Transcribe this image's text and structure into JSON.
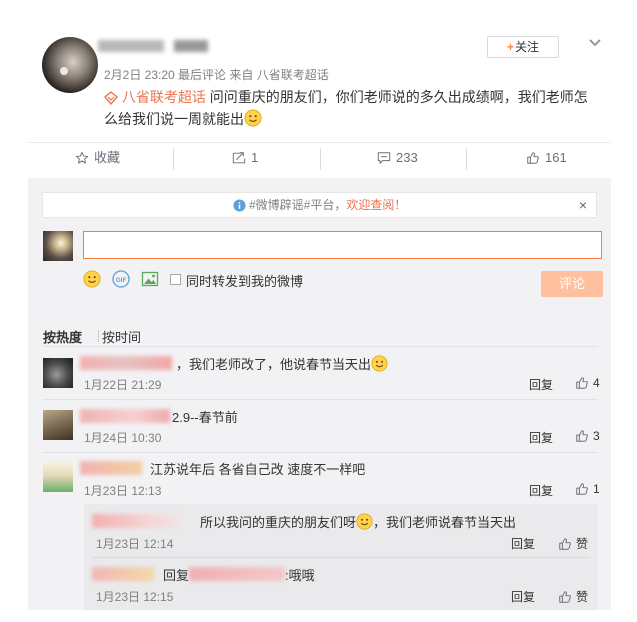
{
  "post": {
    "meta": "2月2日 23:20 最后评论 来自 八省联考超话",
    "follow_label": "关注",
    "tag": "八省联考超话",
    "text_line1": " 问问重庆的朋友们，你们老师说的多久出成绩啊，我们老师怎",
    "text_line2": "么给我们说一周就能出"
  },
  "actions": {
    "collect_label": "收藏",
    "forward_count": "1",
    "comment_count": "233",
    "like_count": "161"
  },
  "notice": {
    "hash_text": "#微博辟谣#平台，",
    "link_text": "欢迎查阅！",
    "close": "×"
  },
  "composer": {
    "input_value": "",
    "forward_label": "同时转发到我的微博",
    "submit_label": "评论"
  },
  "sort": {
    "hot_label": "按热度",
    "time_label": "按时间"
  },
  "comments": [
    {
      "text": "，我们老师改了，他说春节当天出",
      "time": "1月22日 21:29",
      "reply": "回复",
      "likes": "4"
    },
    {
      "text": "2.9--春节前",
      "time": "1月24日 10:30",
      "reply": "回复",
      "likes": "3"
    },
    {
      "text": "江苏说年后 各省自己改 速度不一样吧",
      "time": "1月23日 12:13",
      "reply": "回复",
      "likes": "1"
    }
  ],
  "replies": [
    {
      "text_a": "所以我问的重庆的朋友们呀",
      "text_b": "，我们老师说春节当天出",
      "time": "1月23日 12:14",
      "reply": "回复",
      "like_label": "赞"
    },
    {
      "prefix": "回复",
      "text": ":哦哦",
      "time": "1月23日 12:15",
      "reply": "回复",
      "like_label": "赞"
    }
  ],
  "colors": {
    "accent": "#eb7350",
    "input_border": "#fa7d3c",
    "submit_bg": "#ffc09f",
    "panel_bg": "#f2f2f5",
    "notice_icon": "#5e9fd6"
  },
  "icons": {
    "more": "chevron-down-icon",
    "tag": "supertopic-diamond-icon",
    "emoji": "smile-face-icon",
    "collect": "star-outline-icon",
    "forward": "forward-arrow-icon",
    "comment": "comment-bubble-icon",
    "like": "thumbs-up-icon",
    "notice": "info-circle-icon",
    "gif": "gif-icon",
    "image": "image-icon"
  }
}
